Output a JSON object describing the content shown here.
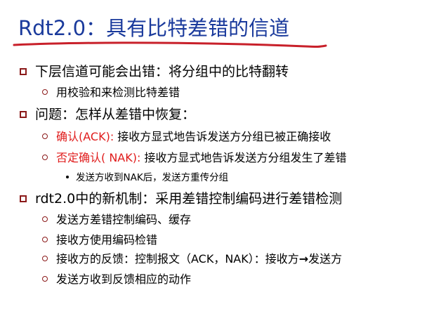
{
  "title": {
    "prefix": "Rdt2.0：",
    "main": "具有比特差错的信道"
  },
  "colors": {
    "title": "#1a3a9c",
    "underline": "#c8202a",
    "accent_red": "#e01b1b",
    "bullet": "#8b1a1a"
  },
  "items": [
    {
      "text": "下层信道可能会出错：将分组中的比特翻转"
    },
    {
      "text": "用校验和来检测比特差错"
    },
    {
      "text": "问题：怎样从差错中恢复："
    },
    {
      "red": "确认(ACK):",
      "rest": " 接收方显式地告诉发送方分组已被正确接收"
    },
    {
      "red": "否定确认( NAK):",
      "rest": " 接收方显式地告诉发送方分组发生了差错"
    },
    {
      "text": "发送方收到NAK后，发送方重传分组"
    },
    {
      "text": "rdt2.0中的新机制：采用差错控制编码进行差错检测"
    },
    {
      "text": "发送方差错控制编码、缓存"
    },
    {
      "text": "接收方使用编码检错"
    },
    {
      "pre": "接收方的反馈：控制报文（ACK，NAK）：接收方",
      "arrow": "→",
      "post": "发送方"
    },
    {
      "text": "发送方收到反馈相应的动作"
    }
  ]
}
